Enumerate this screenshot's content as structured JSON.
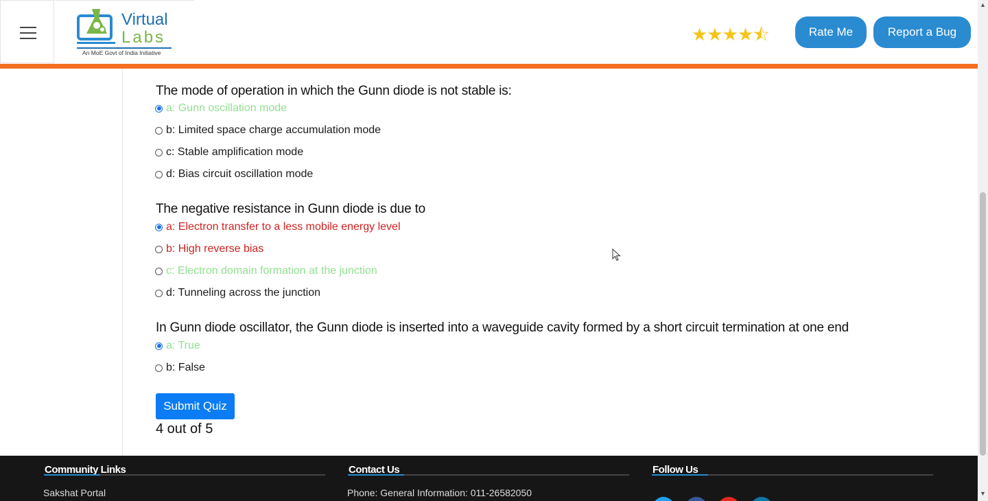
{
  "header": {
    "logo_line1": "Virtual",
    "logo_line2": "Labs",
    "logo_tagline": "An MoE Govt of India Initiative",
    "rating_stars": "★★★★⯪",
    "rating_value": 4.5,
    "rate_button": "Rate Me",
    "bug_button": "Report a Bug"
  },
  "colors": {
    "accent_orange": "#f36f21",
    "button_blue": "#2a8bd1",
    "correct_green": "#90e090",
    "wrong_red": "#d01f1f",
    "submit_blue": "#0b7cf3"
  },
  "quiz": {
    "questions": [
      {
        "title": "The mode of operation in which the Gunn diode is not stable is:",
        "options": [
          {
            "label": "a: Gunn oscillation mode",
            "checked": true,
            "state": "correct"
          },
          {
            "label": "b: Limited space charge accumulation mode",
            "checked": false,
            "state": "normal"
          },
          {
            "label": "c: Stable amplification mode",
            "checked": false,
            "state": "normal"
          },
          {
            "label": "d: Bias circuit oscillation mode",
            "checked": false,
            "state": "normal"
          }
        ]
      },
      {
        "title": "The negative resistance in Gunn diode is due to",
        "options": [
          {
            "label": "a: Electron transfer to a less mobile energy level",
            "checked": true,
            "state": "wrong"
          },
          {
            "label": "b: High reverse bias",
            "checked": false,
            "state": "wrong"
          },
          {
            "label": "c: Electron domain formation at the junction",
            "checked": false,
            "state": "correct"
          },
          {
            "label": "d: Tunneling across the junction",
            "checked": false,
            "state": "normal"
          }
        ]
      },
      {
        "title": "In Gunn diode oscillator, the Gunn diode is inserted into a waveguide cavity formed by a short circuit termination at one end",
        "options": [
          {
            "label": "a: True",
            "checked": true,
            "state": "correct"
          },
          {
            "label": "b: False",
            "checked": false,
            "state": "normal"
          }
        ]
      }
    ],
    "submit_label": "Submit Quiz",
    "score": "4 out of 5"
  },
  "footer": {
    "community_heading": "Community Links",
    "community_first": "Sakshat Portal",
    "contact_heading": "Contact Us",
    "contact_first": "Phone: General Information: 011-26582050",
    "follow_heading": "Follow Us"
  }
}
